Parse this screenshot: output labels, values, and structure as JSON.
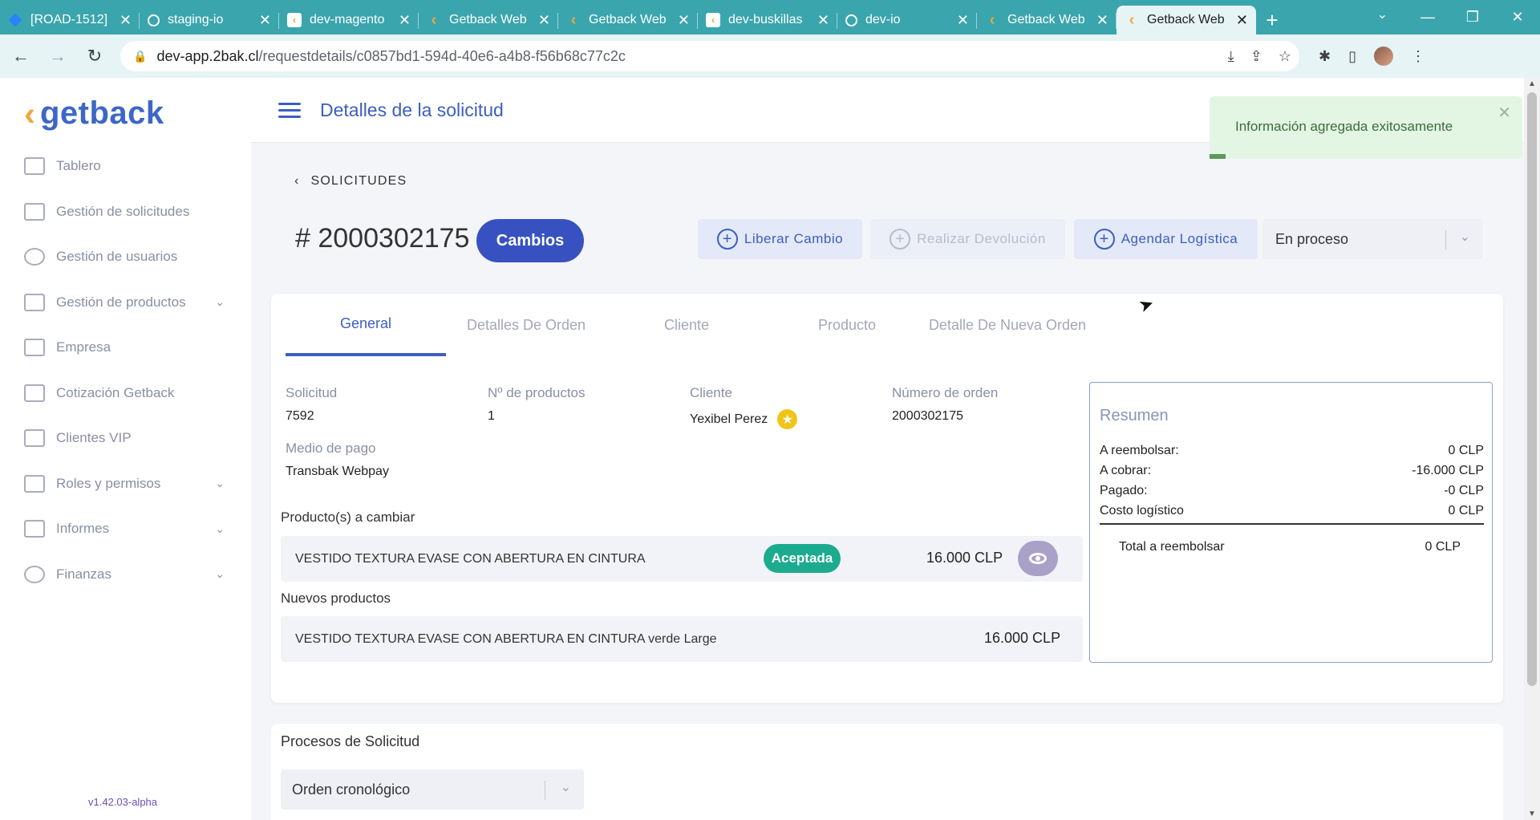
{
  "browser": {
    "tabs": [
      {
        "title": "[ROAD-1512]",
        "icon": "jira"
      },
      {
        "title": "staging-io",
        "icon": "ring"
      },
      {
        "title": "dev-magento",
        "icon": "mag"
      },
      {
        "title": "Getback Web",
        "icon": "gb"
      },
      {
        "title": "Getback Web",
        "icon": "gb"
      },
      {
        "title": "dev-buskillas",
        "icon": "mag"
      },
      {
        "title": "dev-io",
        "icon": "ring"
      },
      {
        "title": "Getback Web",
        "icon": "gb"
      },
      {
        "title": "Getback Web",
        "icon": "gb",
        "active": true
      }
    ],
    "url_host": "dev-app.2bak.cl",
    "url_path": "/requestdetails/c0857bd1-594d-40e6-a4b8-f56b68c77c2c"
  },
  "sidebar": {
    "logo_text": "getback",
    "items": [
      {
        "label": "Tablero",
        "icon": "dashboard-icon",
        "expandable": false
      },
      {
        "label": "Gestión de solicitudes",
        "icon": "requests-icon",
        "expandable": false
      },
      {
        "label": "Gestión de usuarios",
        "icon": "users-icon",
        "expandable": false
      },
      {
        "label": "Gestión de productos",
        "icon": "box-icon",
        "expandable": true
      },
      {
        "label": "Empresa",
        "icon": "building-icon",
        "expandable": false
      },
      {
        "label": "Cotización Getback",
        "icon": "building-icon",
        "expandable": false
      },
      {
        "label": "Clientes VIP",
        "icon": "building-icon",
        "expandable": false
      },
      {
        "label": "Roles y permisos",
        "icon": "id-card-icon",
        "expandable": true
      },
      {
        "label": "Informes",
        "icon": "report-icon",
        "expandable": true
      },
      {
        "label": "Finanzas",
        "icon": "dollar-icon",
        "expandable": true
      }
    ],
    "version": "v1.42.03-alpha"
  },
  "header": {
    "title": "Detalles de la solicitud"
  },
  "toast": {
    "message": "Información agregada exitosamente"
  },
  "request": {
    "back_label": "SOLICITUDES",
    "number": "# 2000302175",
    "type_badge": "Cambios",
    "actions": {
      "release": "Liberar Cambio",
      "refund": "Realizar Devolución",
      "logistics": "Agendar Logística"
    },
    "status": "En proceso"
  },
  "tabs": [
    "General",
    "Detalles De Orden",
    "Cliente",
    "Producto",
    "Detalle De Nueva Orden"
  ],
  "general": {
    "solicitud_label": "Solicitud",
    "solicitud_value": "7592",
    "nprod_label": "Nº de productos",
    "nprod_value": "1",
    "cliente_label": "Cliente",
    "cliente_value": "Yexibel Perez",
    "orden_label": "Número de orden",
    "orden_value": "2000302175",
    "pago_label": "Medio de pago",
    "pago_value": "Transbak Webpay"
  },
  "products": {
    "change_title": "Producto(s) a cambiar",
    "change_item": {
      "name": "VESTIDO TEXTURA EVASE CON ABERTURA EN CINTURA",
      "status": "Aceptada",
      "price": "16.000 CLP"
    },
    "new_title": "Nuevos productos",
    "new_item": {
      "name": "VESTIDO TEXTURA EVASE CON ABERTURA EN CINTURA verde Large",
      "price": "16.000 CLP"
    }
  },
  "summary": {
    "title": "Resumen",
    "rows": [
      {
        "label": "A reembolsar:",
        "value": "0 CLP"
      },
      {
        "label": "A cobrar:",
        "value": "-16.000 CLP"
      },
      {
        "label": "Pagado:",
        "value": "-0 CLP"
      },
      {
        "label": "Costo logístico",
        "value": "0 CLP"
      }
    ],
    "total_label": "Total a reembolsar",
    "total_value": "0 CLP"
  },
  "process": {
    "title": "Procesos de Solicitud",
    "order": "Orden cronológico"
  },
  "colors": {
    "brand": "#3c5fbf",
    "accent": "#f2a63b",
    "accepted": "#1cab8e",
    "tabstrip": "#3aa5ad"
  }
}
